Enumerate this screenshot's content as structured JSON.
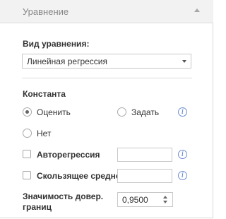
{
  "header": {
    "title": "Уравнение"
  },
  "equation_type": {
    "label": "Вид уравнения:",
    "selected": "Линейная регрессия"
  },
  "constant": {
    "label": "Константа",
    "options": [
      {
        "label": "Оценить",
        "checked": true
      },
      {
        "label": "Задать",
        "checked": false
      },
      {
        "label": "Нет",
        "checked": false
      }
    ]
  },
  "autoregression": {
    "label": "Авторегрессия",
    "checked": false,
    "value": ""
  },
  "moving_average": {
    "label": "Скользящее среднее",
    "checked": false,
    "value": ""
  },
  "confidence": {
    "label_line1": "Значимость довер.",
    "label_line2": "границ",
    "value": "0,9500"
  },
  "icons": {
    "info": "i"
  },
  "colors": {
    "header_bg": "#f2f2f2",
    "info_icon": "#4f73c4"
  }
}
